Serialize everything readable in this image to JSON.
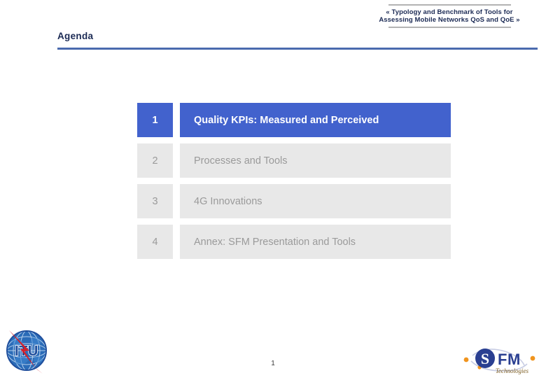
{
  "slide": {
    "running_title_line1": "« Typology and Benchmark of Tools for",
    "running_title_line2": "Assessing Mobile Networks QoS and QoE »",
    "title": "Agenda",
    "page_number": "1"
  },
  "agenda": {
    "items": [
      {
        "number": "1",
        "label": "Quality KPIs: Measured and Perceived",
        "active": true
      },
      {
        "number": "2",
        "label": "Processes and Tools",
        "active": false
      },
      {
        "number": "3",
        "label": "4G Innovations",
        "active": false
      },
      {
        "number": "4",
        "label": "Annex: SFM Presentation and Tools",
        "active": false
      }
    ]
  },
  "logos": {
    "itu": {
      "name": "itu-logo",
      "text": "ITU"
    },
    "sfm": {
      "name": "sfm-logo",
      "letter": "S",
      "text": "FM",
      "tagline": "Technologies"
    }
  },
  "colors": {
    "accent_blue": "#4262cd",
    "rule_blue": "#4a6aae",
    "title_navy": "#1b2a54",
    "inactive_bg": "#e8e8e8",
    "inactive_text": "#9a9a9a",
    "header_rule_gray": "#b3b3b3",
    "itu_blue": "#1f4e9c",
    "itu_red": "#d4202a",
    "sfm_blue": "#2a3f91",
    "sfm_orange": "#f0941e"
  }
}
